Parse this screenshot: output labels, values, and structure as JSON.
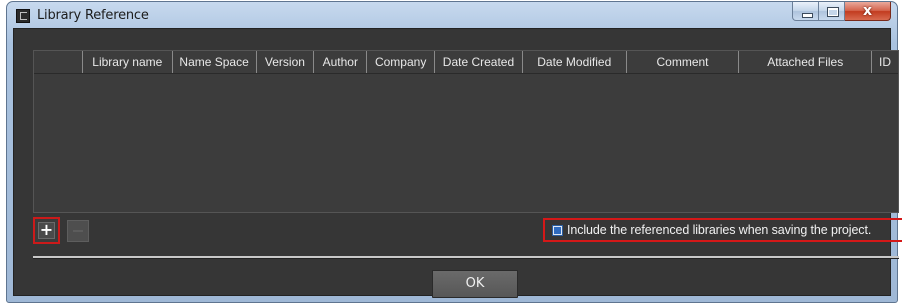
{
  "window": {
    "title": "Library Reference",
    "icon": "app-icon",
    "controls": {
      "minimize": "minimize-icon",
      "maximize": "maximize-icon",
      "close_label": "x"
    }
  },
  "grid": {
    "columns": [
      {
        "label": ""
      },
      {
        "label": "Library name"
      },
      {
        "label": "Name Space"
      },
      {
        "label": "Version"
      },
      {
        "label": "Author"
      },
      {
        "label": "Company"
      },
      {
        "label": "Date Created"
      },
      {
        "label": "Date Modified"
      },
      {
        "label": "Comment"
      },
      {
        "label": "Attached Files"
      },
      {
        "label": "ID"
      }
    ],
    "rows": []
  },
  "toolbar": {
    "add_label": "+",
    "add_icon": "plus-icon",
    "remove_icon": "minus-icon"
  },
  "options": {
    "include_libraries_label": "Include the referenced libraries when saving the project.",
    "include_libraries_checked": true
  },
  "footer": {
    "ok_label": "OK"
  },
  "colors": {
    "highlight": "#d41818",
    "client_bg": "#363636",
    "checkbox_fill": "#2f6bc0"
  }
}
